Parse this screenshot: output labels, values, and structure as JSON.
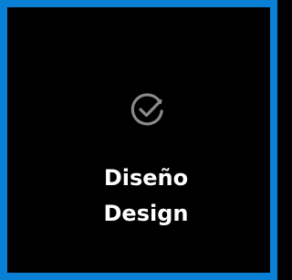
{
  "tile": {
    "title_es": "Diseño",
    "title_en": "Design",
    "icon": "check-circle-icon",
    "border_color": "#0a7fd6",
    "background_color": "#000000",
    "icon_color": "#8a8a8a",
    "text_color": "#ffffff"
  }
}
